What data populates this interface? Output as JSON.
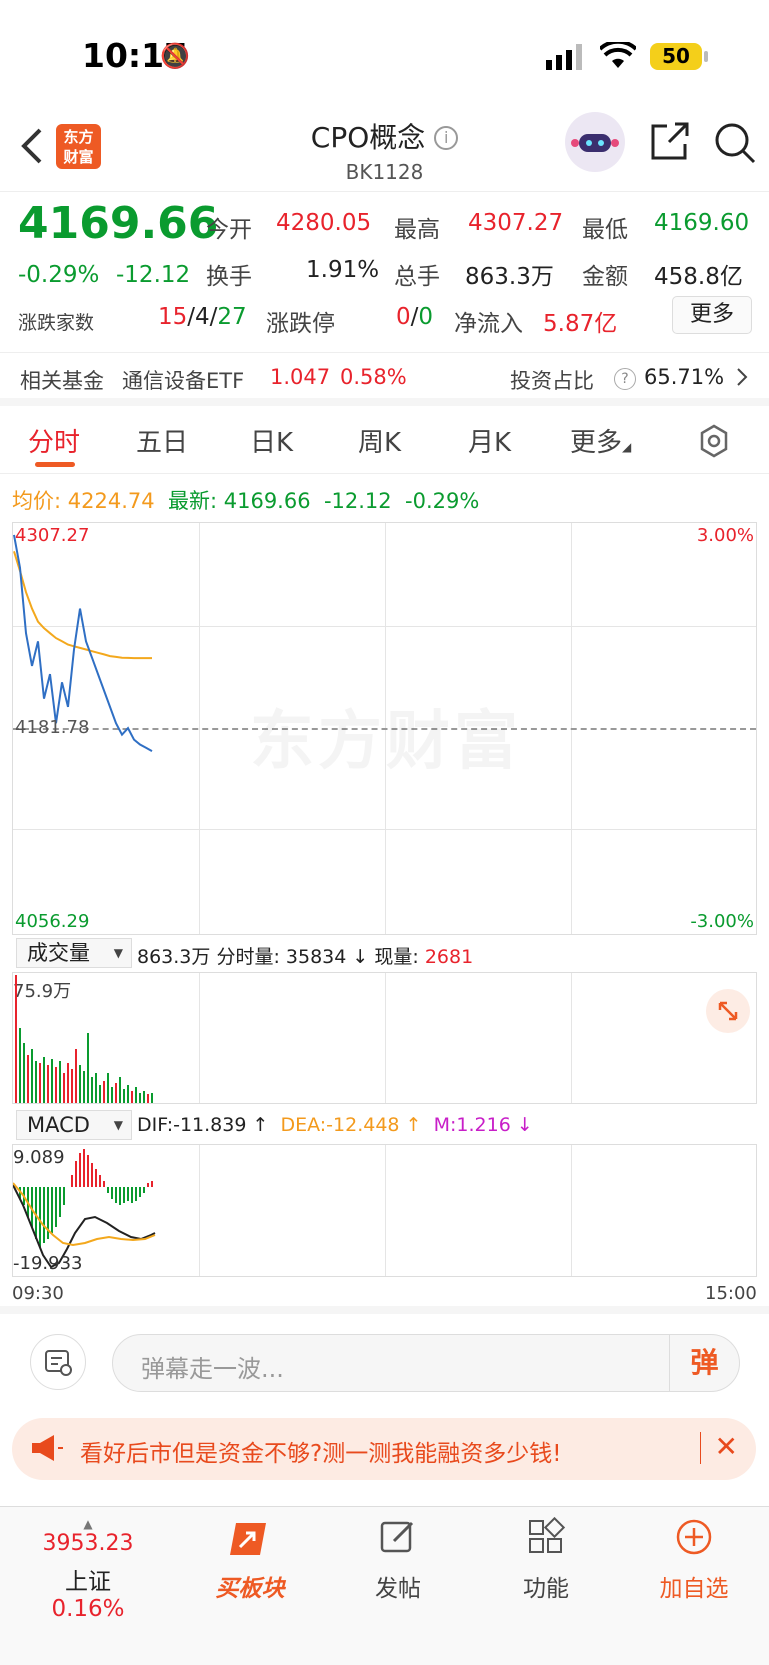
{
  "status_bar": {
    "time": "10:17",
    "battery": "50"
  },
  "header": {
    "logo_line1": "东方",
    "logo_line2": "财富",
    "title": "CPO概念",
    "code": "BK1128"
  },
  "quote": {
    "price": "4169.66",
    "change_pct": "-0.29%",
    "change": "-12.12",
    "open_label": "今开",
    "open": "4280.05",
    "high_label": "最高",
    "high": "4307.27",
    "low_label": "最低",
    "low": "4169.60",
    "turnover_label": "换手",
    "turnover": "1.91%",
    "volume_label": "总手",
    "volume": "863.3万",
    "amount_label": "金额",
    "amount": "458.8亿",
    "breadth_label": "涨跌家数",
    "breadth_up": "15",
    "breadth_flat": "4",
    "breadth_down": "27",
    "limit_label": "涨跌停",
    "limit_up": "0",
    "limit_down": "0",
    "netflow_label": "净流入",
    "netflow": "5.87亿",
    "more_label": "更多"
  },
  "fund": {
    "label": "相关基金",
    "name": "通信设备ETF",
    "price": "1.047",
    "pct": "0.58%",
    "ratio_label": "投资占比",
    "ratio": "65.71%"
  },
  "tabs": [
    "分时",
    "五日",
    "日K",
    "周K",
    "月K",
    "更多"
  ],
  "info": {
    "avg_label": "均价:",
    "avg": "4224.74",
    "latest_label": "最新:",
    "latest": "4169.66",
    "latest_change": "-12.12",
    "latest_pct": "-0.29%"
  },
  "price_chart": {
    "top": "4307.27",
    "mid": "4181.78",
    "bottom": "4056.29",
    "top_pct": "3.00%",
    "bottom_pct": "-3.00%",
    "watermark": "东方财富"
  },
  "volume_panel": {
    "selector": "成交量",
    "total": "863.3万",
    "tick_label": "分时量:",
    "tick": "35834",
    "now_label": "现量:",
    "now": "2681",
    "max": "75.9万"
  },
  "macd_panel": {
    "selector": "MACD",
    "dif": "DIF:-11.839",
    "dea": "DEA:-12.448",
    "m": "M:1.216",
    "top": "9.089",
    "bottom": "-19.933"
  },
  "time_axis": {
    "start": "09:30",
    "end": "15:00"
  },
  "danmu": {
    "placeholder": "弹幕走一波...",
    "button": "弹"
  },
  "promo": {
    "text": "看好后市但是资金不够?测一测我能融资多少钱!"
  },
  "bottom_nav": {
    "index_value": "3953.23",
    "index_name": "上证",
    "index_pct": "0.16%",
    "buy_label": "买板块",
    "post_label": "发帖",
    "func_label": "功能",
    "add_label": "加自选"
  },
  "chart_data": {
    "type": "line",
    "series": [
      {
        "values": [
          4300,
          4280,
          4240,
          4220,
          4235,
          4200,
          4215,
          4185,
          4210,
          4195,
          4230,
          4255,
          4235,
          4225,
          4215,
          4205,
          4195,
          4185,
          4178,
          4182,
          4175,
          4172,
          4170,
          4168
        ]
      },
      {
        "values": [
          4290,
          4278,
          4265,
          4255,
          4247,
          4243,
          4240,
          4237,
          4235,
          4233,
          4232,
          4231,
          4230,
          4229,
          4228,
          4227,
          4226,
          4225.5,
          4225,
          4224.9,
          4224.8,
          4224.78,
          4224.76,
          4224.74
        ]
      }
    ],
    "ylim": [
      4056.29,
      4307.27
    ],
    "colors": {
      "price": "#2f6fc4",
      "avg": "#f3a81d"
    }
  }
}
